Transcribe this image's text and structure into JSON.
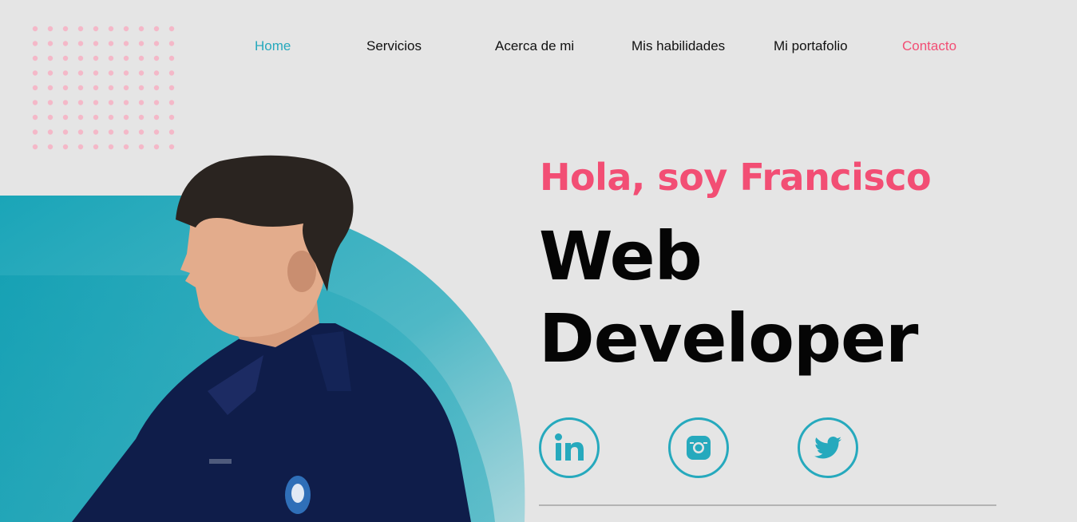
{
  "colors": {
    "accent_teal": "#26a9bd",
    "accent_pink": "#f24e74",
    "background": "#e5e5e5",
    "text": "#111111"
  },
  "nav": {
    "items": [
      {
        "label": "Home",
        "state": "active"
      },
      {
        "label": "Servicios"
      },
      {
        "label": "Acerca de mi"
      },
      {
        "label": "Mis habilidades"
      },
      {
        "label": "Mi portafolio"
      },
      {
        "label": "Contacto",
        "style": "highlight"
      }
    ]
  },
  "hero": {
    "greeting": "Hola, soy Francisco",
    "title_line1": "Web",
    "title_line2": "Developer",
    "photo_icon": "profile-photo"
  },
  "social": [
    {
      "icon": "linkedin-icon"
    },
    {
      "icon": "instagram-icon"
    },
    {
      "icon": "twitter-icon"
    }
  ]
}
